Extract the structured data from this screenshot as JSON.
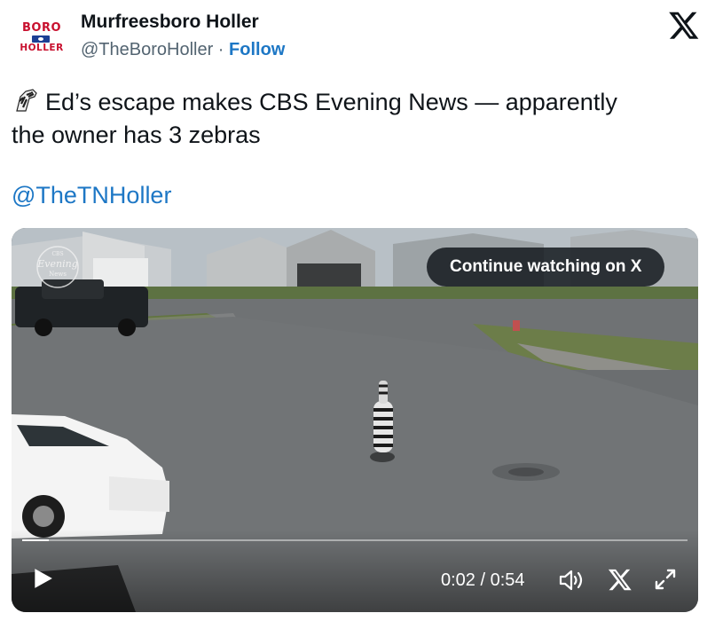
{
  "author": {
    "logo_line1": "BORO",
    "logo_line2": "HOLLER",
    "name": "Murfreesboro Holler",
    "handle": "@TheBoroHoller",
    "separator": " · ",
    "follow_label": "Follow"
  },
  "tweet": {
    "text_line1": "Ed’s escape makes CBS Evening News — apparently",
    "text_line2": "the owner has 3 zebras",
    "mention": "@TheTNHoller",
    "emoji_icon": "zebra-emoji-icon"
  },
  "video": {
    "watermark_line1": "CBS",
    "watermark_line2": "Evening",
    "watermark_line3": "News",
    "continue_label": "Continue watching on X",
    "time_display": "0:02 / 0:54",
    "progress": 0.04
  },
  "colors": {
    "brand_red": "#c8102e",
    "link_blue": "#1d77c5",
    "text_primary": "#0f1419",
    "text_secondary": "#536471"
  },
  "icons": [
    "x-logo-icon",
    "play-icon",
    "volume-icon",
    "x-icon",
    "fullscreen-icon"
  ]
}
